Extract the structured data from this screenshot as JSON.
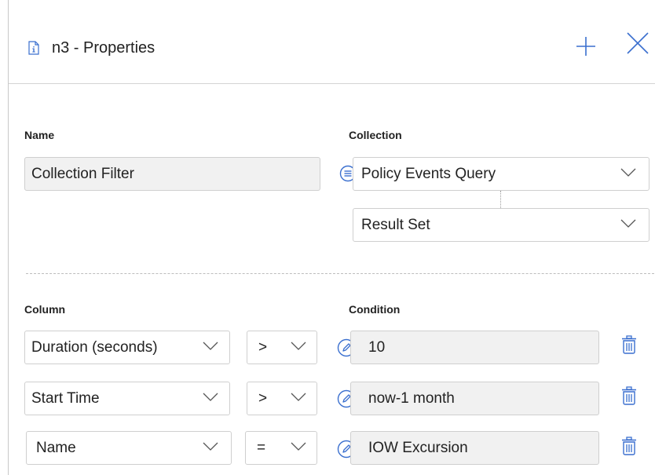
{
  "header": {
    "title": "n3 - Properties"
  },
  "fields": {
    "name_label": "Name",
    "name_value": "Collection Filter",
    "collection_label": "Collection",
    "collection_value": "Policy Events Query",
    "result_value": "Result Set"
  },
  "filters": {
    "column_label": "Column",
    "condition_label": "Condition",
    "rows": [
      {
        "column": "Duration (seconds)",
        "operator": ">",
        "condition": "10"
      },
      {
        "column": "Start Time",
        "operator": ">",
        "condition": "now-1 month"
      },
      {
        "column": "Name",
        "operator": "=",
        "condition": "IOW Excursion"
      }
    ]
  },
  "colors": {
    "accent": "#3a6fcf",
    "border": "#cfcfcf",
    "field_bg": "#f1f1f1"
  },
  "icons": {
    "header": "document-info-icon",
    "add": "plus-icon",
    "close": "close-icon",
    "collection": "list-icon",
    "condition": "pencil-icon",
    "delete": "trash-icon",
    "dropdown": "chevron-down-icon"
  }
}
